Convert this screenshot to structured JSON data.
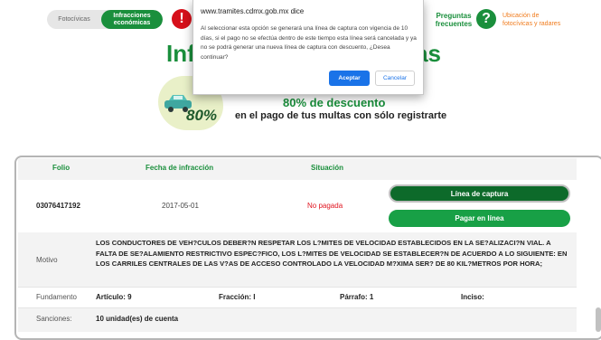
{
  "nav": {
    "tab_fotocivicas": "Fotocívicas",
    "tab_infracciones": "Infracciones económicas",
    "alert_glyph": "!",
    "faq_label": "Preguntas frecuentes",
    "faq_glyph": "?",
    "ubicacion": "Ubicación de fotocívicas y radares"
  },
  "page": {
    "title_left": "Inf",
    "title_right": "as",
    "promo_badge": "80%",
    "promo_pct": "80% de descuento",
    "promo_text": "en el pago de tus multas con sólo registrarte"
  },
  "table": {
    "headers": {
      "folio": "Folio",
      "fecha": "Fecha de infracción",
      "situacion": "Situación"
    },
    "row": {
      "folio": "03076417192",
      "fecha": "2017-05-01",
      "situacion": "No pagada",
      "btn_linea": "Línea de captura",
      "btn_pagar": "Pagar en línea"
    },
    "motivo_label": "Motivo",
    "motivo_text": "LOS CONDUCTORES DE VEH?CULOS DEBER?N RESPETAR LOS L?MITES DE VELOCIDAD ESTABLECIDOS EN LA SE?ALIZACI?N VIAL. A FALTA DE SE?ALAMIENTO RESTRICTIVO ESPEC?FICO, LOS L?MITES DE VELOCIDAD SE ESTABLECER?N DE ACUERDO A LO SIGUIENTE: EN LOS CARRILES CENTRALES DE LAS V?AS DE ACCESO CONTROLADO LA VELOCIDAD M?XIMA SER? DE 80 KIL?METROS POR HORA;",
    "fundamento_label": "Fundamento",
    "articulo": "Artículo: 9",
    "fraccion": "Fracción: I",
    "parrafo": "Párrafo: 1",
    "inciso": "Inciso:",
    "sanciones_label": "Sanciones:",
    "sanciones_value": "10 unidad(es) de cuenta"
  },
  "dialog": {
    "title": "www.tramites.cdmx.gob.mx dice",
    "message": "Al seleccionar esta opción se generará una línea de captura con vigencia de 10 días, si el pago no se efectúa dentro de este tiempo esta línea será cancelada y ya no se podrá generar una nueva línea de captura con descuento, ¿Desea continuar?",
    "accept": "Aceptar",
    "cancel": "Cancelar"
  },
  "colors": {
    "brand_green": "#1a8f3c",
    "alert_red": "#d60f1a",
    "orange": "#f07c1e",
    "dialog_blue": "#1a73e8"
  }
}
